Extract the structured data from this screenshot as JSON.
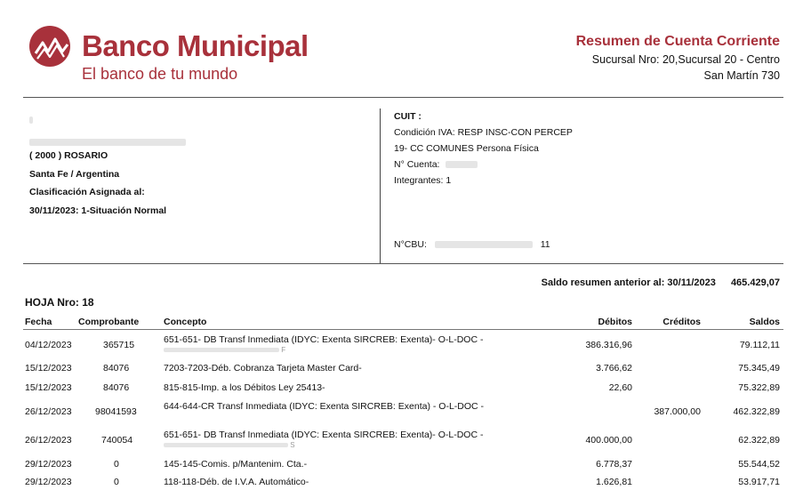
{
  "bank": {
    "name": "Banco Municipal",
    "tagline": "El banco de tu mundo",
    "logo_icon": "banco-municipal-logo",
    "brand_color": "#a8313b"
  },
  "document": {
    "title": "Resumen de Cuenta Corriente",
    "branch_line1": "Sucursal Nro: 20,Sucursal 20 - Centro",
    "branch_line2": "San Martín 730"
  },
  "client": {
    "city": "( 2000 ) ROSARIO",
    "province": "Santa Fe / Argentina",
    "classification_label": "Clasificación Asignada al:",
    "classification_value": "30/11/2023: 1-Situación Normal"
  },
  "account": {
    "cuit_label": "CUIT :",
    "iva": "Condición IVA: RESP INSC-CON PERCEP",
    "type": "19- CC COMUNES Persona Física",
    "cuenta_label": "N° Cuenta:",
    "integrantes": "Integrantes: 1",
    "cbu_label": "N°CBU:",
    "cbu_tail": "11"
  },
  "summary": {
    "prev_balance_label": "Saldo resumen anterior al: 30/11/2023",
    "prev_balance_value": "465.429,07",
    "sheet": "HOJA Nro: 18"
  },
  "table": {
    "headers": {
      "fecha": "Fecha",
      "comprobante": "Comprobante",
      "concepto": "Concepto",
      "debitos": "Débitos",
      "creditos": "Créditos",
      "saldos": "Saldos"
    },
    "rows": [
      {
        "fecha": "04/12/2023",
        "comprobante": "365715",
        "concepto": "651-651- DB Transf Inmediata (IDYC: Exenta SIRCREB: Exenta)- O-L-DOC -",
        "debito": "386.316,96",
        "credito": "",
        "saldo": "79.112,11"
      },
      {
        "fecha": "15/12/2023",
        "comprobante": "84076",
        "concepto": "7203-7203-Déb. Cobranza Tarjeta Master Card-",
        "debito": "3.766,62",
        "credito": "",
        "saldo": "75.345,49"
      },
      {
        "fecha": "15/12/2023",
        "comprobante": "84076",
        "concepto": "815-815-Imp. a los Débitos Ley 25413-",
        "debito": "22,60",
        "credito": "",
        "saldo": "75.322,89"
      },
      {
        "fecha": "26/12/2023",
        "comprobante": "98041593",
        "concepto": "644-644-CR Transf Inmediata (IDYC: Exenta SIRCREB: Exenta) - O-L-DOC -",
        "debito": "",
        "credito": "387.000,00",
        "saldo": "462.322,89"
      },
      {
        "fecha": "26/12/2023",
        "comprobante": "740054",
        "concepto": "651-651- DB Transf Inmediata (IDYC: Exenta SIRCREB: Exenta)- O-L-DOC -",
        "debito": "400.000,00",
        "credito": "",
        "saldo": "62.322,89"
      },
      {
        "fecha": "29/12/2023",
        "comprobante": "0",
        "concepto": "145-145-Comis. p/Mantenim. Cta.-",
        "debito": "6.778,37",
        "credito": "",
        "saldo": "55.544,52"
      },
      {
        "fecha": "29/12/2023",
        "comprobante": "0",
        "concepto": "118-118-Déb. de I.V.A. Automático-",
        "debito": "1.626,81",
        "credito": "",
        "saldo": "53.917,71"
      }
    ]
  }
}
